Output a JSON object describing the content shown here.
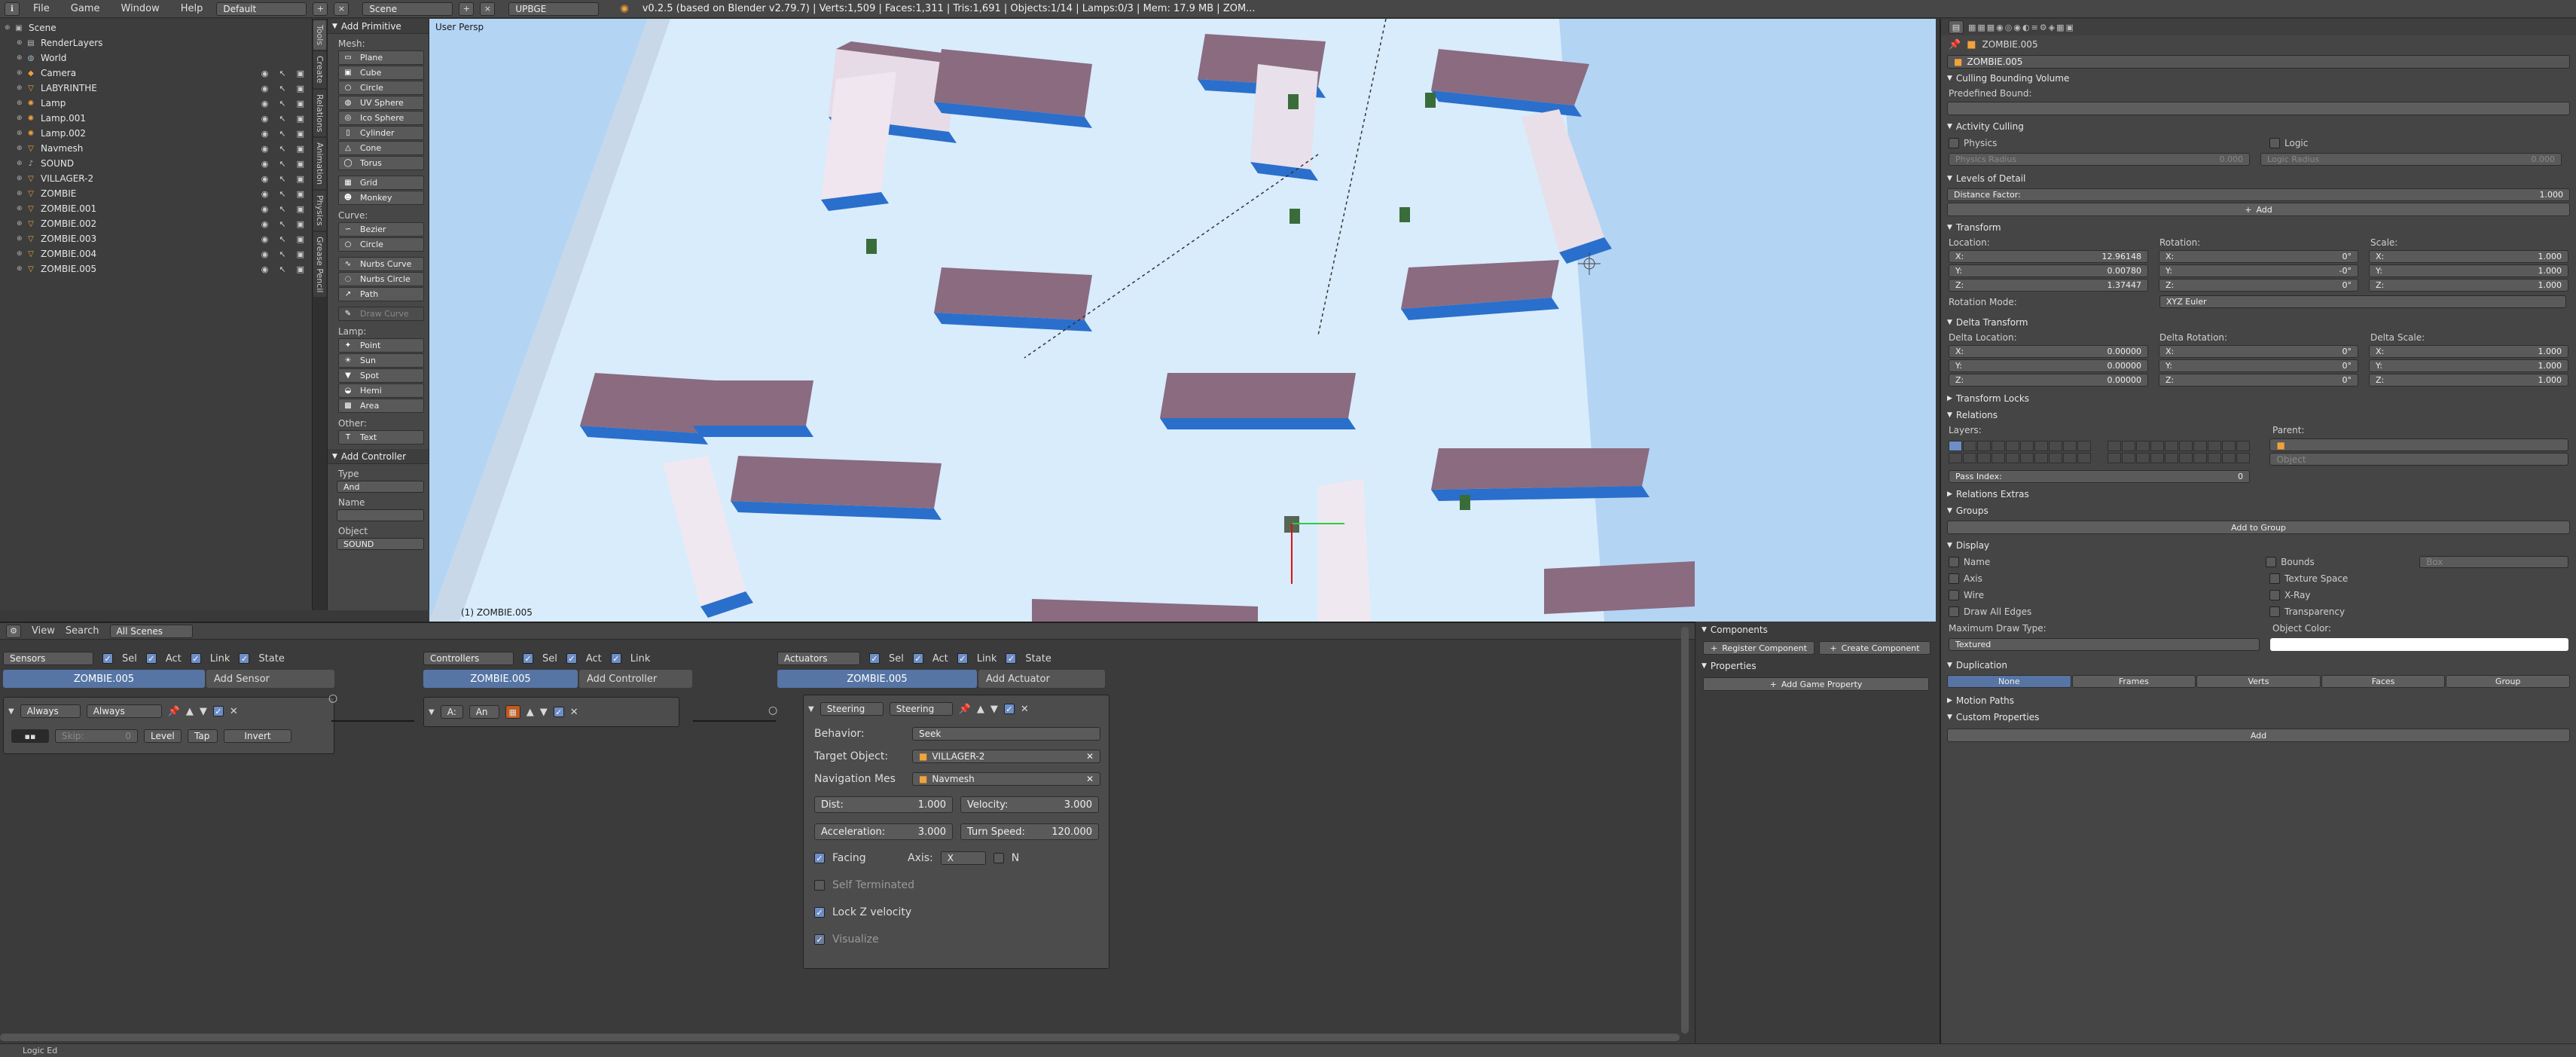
{
  "topbar": {
    "menus": [
      "File",
      "Game",
      "Window",
      "Help"
    ],
    "layout": "Default",
    "scene": "Scene",
    "engine": "UPBGE",
    "stats": "v0.2.5 (based on Blender v2.79.7) | Verts:1,509 | Faces:1,311 | Tris:1,691 | Objects:1/14 | Lamps:0/3 | Mem: 17.9 MB | ZOM..."
  },
  "outliner": {
    "items": [
      {
        "label": "Scene",
        "indent": 0,
        "icon": "scene"
      },
      {
        "label": "RenderLayers",
        "indent": 1,
        "icon": "renderlayers"
      },
      {
        "label": "World",
        "indent": 1,
        "icon": "world"
      },
      {
        "label": "Camera",
        "indent": 1,
        "icon": "camera"
      },
      {
        "label": "LABYRINTHE",
        "indent": 1,
        "icon": "mesh"
      },
      {
        "label": "Lamp",
        "indent": 1,
        "icon": "lamp"
      },
      {
        "label": "Lamp.001",
        "indent": 1,
        "icon": "lamp"
      },
      {
        "label": "Lamp.002",
        "indent": 1,
        "icon": "lamp"
      },
      {
        "label": "Navmesh",
        "indent": 1,
        "icon": "mesh"
      },
      {
        "label": "SOUND",
        "indent": 1,
        "icon": "speaker"
      },
      {
        "label": "VILLAGER-2",
        "indent": 1,
        "icon": "mesh"
      },
      {
        "label": "ZOMBIE",
        "indent": 1,
        "icon": "mesh"
      },
      {
        "label": "ZOMBIE.001",
        "indent": 1,
        "icon": "mesh"
      },
      {
        "label": "ZOMBIE.002",
        "indent": 1,
        "icon": "mesh"
      },
      {
        "label": "ZOMBIE.003",
        "indent": 1,
        "icon": "mesh"
      },
      {
        "label": "ZOMBIE.004",
        "indent": 1,
        "icon": "mesh"
      },
      {
        "label": "ZOMBIE.005",
        "indent": 1,
        "icon": "mesh"
      }
    ]
  },
  "tool_tabs": [
    "Tools",
    "Create",
    "Relations",
    "Animation",
    "Physics",
    "Grease Pencil"
  ],
  "toolshelf": {
    "header": "Add Primitive",
    "mesh_label": "Mesh:",
    "mesh": [
      "Plane",
      "Cube",
      "Circle",
      "UV Sphere",
      "Ico Sphere",
      "Cylinder",
      "Cone",
      "Torus"
    ],
    "mesh2": [
      "Grid",
      "Monkey"
    ],
    "curve_label": "Curve:",
    "curve": [
      "Bezier",
      "Circle"
    ],
    "curve2": [
      "Nurbs Curve",
      "Nurbs Circle",
      "Path"
    ],
    "draw_curve": "Draw Curve",
    "lamp_label": "Lamp:",
    "lamp": [
      "Point",
      "Sun",
      "Spot",
      "Hemi",
      "Area"
    ],
    "other_label": "Other:",
    "other": [
      "Text"
    ],
    "controller_header": "Add Controller",
    "type_label": "Type",
    "type_value": "And",
    "name_label": "Name",
    "object_label": "Object",
    "object_value": "SOUND"
  },
  "viewport": {
    "label": "User Persp",
    "object_label": "(1) ZOMBIE.005",
    "colors": {
      "sky": "#b4d4f4",
      "floor": "#d8ecfb",
      "wall_top": "#8a6b80",
      "wall_side": "#e8e0ea",
      "shadow": "#2a6fcb"
    }
  },
  "logic_header": {
    "view": "View",
    "search": "Search",
    "filter": "All Scenes"
  },
  "sensors": {
    "title": "Sensors",
    "toggles": [
      "Sel",
      "Act",
      "Link",
      "State"
    ],
    "object": "ZOMBIE.005",
    "add": "Add Sensor",
    "brick": {
      "type": "Always",
      "name": "Always",
      "skip_label": "Skip:",
      "skip_value": "0",
      "level": "Level",
      "tap": "Tap",
      "invert": "Invert"
    }
  },
  "controllers": {
    "title": "Controllers",
    "toggles": [
      "Sel",
      "Act",
      "Link"
    ],
    "object": "ZOMBIE.005",
    "add": "Add Controller",
    "brick": {
      "type": "A:",
      "name": "An"
    }
  },
  "actuators": {
    "title": "Actuators",
    "toggles": [
      "Sel",
      "Act",
      "Link",
      "State"
    ],
    "object": "ZOMBIE.005",
    "add": "Add Actuator",
    "brick": {
      "type": "Steering",
      "name": "Steering",
      "behavior_label": "Behavior:",
      "behavior": "Seek",
      "target_label": "Target Object:",
      "target": "VILLAGER-2",
      "navmesh_label": "Navigation Mes",
      "navmesh": "Navmesh",
      "dist_label": "Dist:",
      "dist": "1.000",
      "velocity_label": "Velocity:",
      "velocity": "3.000",
      "accel_label": "Acceleration:",
      "accel": "3.000",
      "turn_label": "Turn Speed:",
      "turn": "120.000",
      "facing": "Facing",
      "axis_label": "Axis:",
      "axis": "X",
      "n": "N",
      "self_terminated": "Self Terminated",
      "lock_z": "Lock Z velocity",
      "visualize": "Visualize"
    }
  },
  "logic_props": {
    "components": "Components",
    "register": "Register Component",
    "create": "Create Component",
    "properties": "Properties",
    "add_property": "Add Game Property"
  },
  "props": {
    "object_name": "ZOMBIE.005",
    "object_field": "ZOMBIE.005",
    "culling": "Culling Bounding Volume",
    "predefined_bound": "Predefined Bound:",
    "activity_culling": "Activity Culling",
    "physics": "Physics",
    "logic": "Logic",
    "physics_radius": "Physics Radius",
    "physics_radius_val": "0.000",
    "logic_radius": "Logic Radius",
    "logic_radius_val": "0.000",
    "lod": "Levels of Detail",
    "distance_factor": "Distance Factor:",
    "distance_factor_val": "1.000",
    "add": "Add",
    "transform": "Transform",
    "location": "Location:",
    "rotation": "Rotation:",
    "scale": "Scale:",
    "loc": [
      "12.96148",
      "0.00780",
      "1.37447"
    ],
    "rot": [
      "0°",
      "-0°",
      "0°"
    ],
    "scl": [
      "1.000",
      "1.000",
      "1.000"
    ],
    "axes": [
      "X:",
      "Y:",
      "Z:"
    ],
    "rotation_mode": "Rotation Mode:",
    "rotation_mode_val": "XYZ Euler",
    "delta_transform": "Delta Transform",
    "delta_location": "Delta Location:",
    "delta_rotation": "Delta Rotation:",
    "delta_scale": "Delta Scale:",
    "dloc": [
      "0.00000",
      "0.00000",
      "0.00000"
    ],
    "drot": [
      "0°",
      "0°",
      "0°"
    ],
    "dscl": [
      "1.000",
      "1.000",
      "1.000"
    ],
    "transform_locks": "Transform Locks",
    "relations": "Relations",
    "layers": "Layers:",
    "parent": "Parent:",
    "object_placeholder": "Object",
    "pass_index": "Pass Index:",
    "pass_index_val": "0",
    "relations_extras": "Relations Extras",
    "groups": "Groups",
    "add_to_group": "Add to Group",
    "display": "Display",
    "display_left": [
      "Name",
      "Axis",
      "Wire",
      "Draw All Edges"
    ],
    "display_right": [
      "Bounds",
      "Texture Space",
      "X-Ray",
      "Transparency"
    ],
    "box": "Box",
    "max_draw_type": "Maximum Draw Type:",
    "max_draw_type_val": "Textured",
    "object_color": "Object Color:",
    "duplication": "Duplication",
    "dup_tabs": [
      "None",
      "Frames",
      "Verts",
      "Faces",
      "Group"
    ],
    "motion_paths": "Motion Paths",
    "custom_properties": "Custom Properties",
    "add2": "Add"
  },
  "status": {
    "text": "Logic Ed"
  }
}
